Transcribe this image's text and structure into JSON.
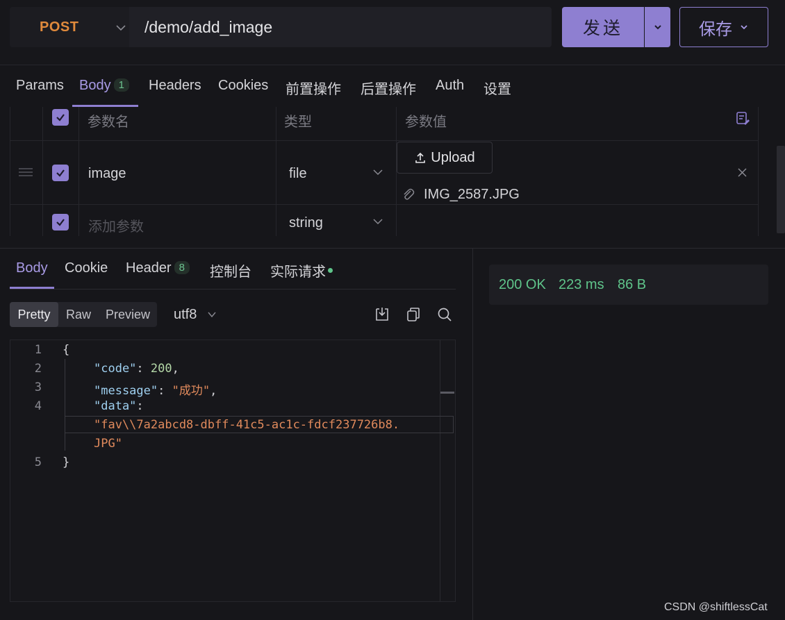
{
  "request": {
    "method": "POST",
    "url": "/demo/add_image",
    "send_label": "发送",
    "save_label": "保存"
  },
  "request_tabs": [
    {
      "label": "Params"
    },
    {
      "label": "Body",
      "badge": "1",
      "active": true
    },
    {
      "label": "Headers"
    },
    {
      "label": "Cookies"
    },
    {
      "label": "前置操作"
    },
    {
      "label": "后置操作"
    },
    {
      "label": "Auth"
    },
    {
      "label": "设置"
    }
  ],
  "params_table": {
    "headers": [
      "参数名",
      "类型",
      "参数值"
    ],
    "rows": [
      {
        "name": "image",
        "type": "file",
        "upload_label": "Upload",
        "file_name": "IMG_2587.JPG",
        "checked": true
      },
      {
        "name_placeholder": "添加参数",
        "type": "string",
        "checked": true
      }
    ]
  },
  "response_tabs": [
    {
      "label": "Body",
      "active": true
    },
    {
      "label": "Cookie"
    },
    {
      "label": "Header",
      "badge": "8"
    },
    {
      "label": "控制台"
    },
    {
      "label": "实际请求",
      "dot": true
    }
  ],
  "view_modes": [
    "Pretty",
    "Raw",
    "Preview"
  ],
  "active_view": "Pretty",
  "encoding": "utf8",
  "code_lines": [
    {
      "num": "1",
      "text": "{"
    },
    {
      "num": "2",
      "key": "\"code\"",
      "value": "200"
    },
    {
      "num": "3",
      "key": "\"message\"",
      "value": "\"成功\""
    },
    {
      "num": "4",
      "key": "\"data\"",
      "value_line1": "\"fav\\\\7a2abcd8-dbff-41c5-ac1c-fdcf237726b8.",
      "value_line2": "JPG\""
    },
    {
      "num": "5",
      "text": "}"
    }
  ],
  "status": {
    "code": "200 OK",
    "time": "223 ms",
    "size": "86 B"
  },
  "watermark": "CSDN @shiftlessCat",
  "colors": {
    "accent": "#8e7fd1",
    "method": "#e08a3c",
    "success": "#5fc48a"
  }
}
